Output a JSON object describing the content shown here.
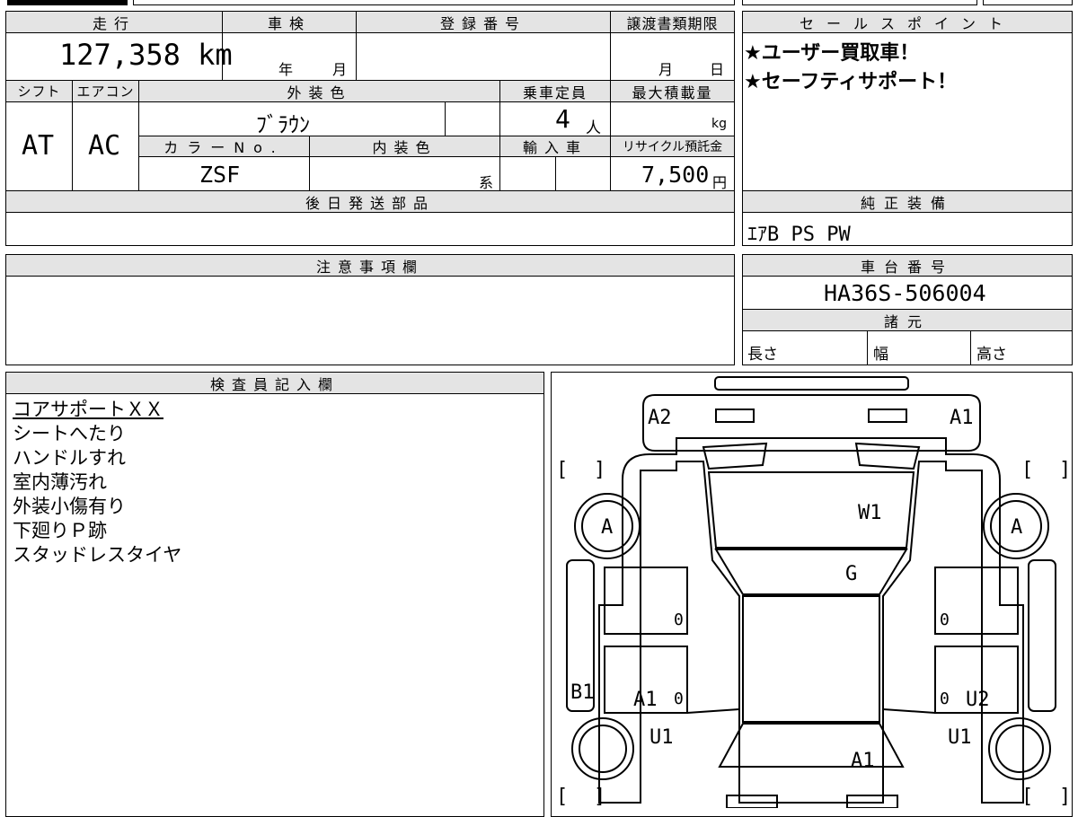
{
  "top": {
    "mileage_label": "走行",
    "mileage_value": "127,358 km",
    "inspection_label": "車検",
    "inspection_year_unit": "年",
    "inspection_month_unit": "月",
    "registration_label": "登録番号",
    "transfer_label": "譲渡書類期限",
    "transfer_month_unit": "月",
    "transfer_day_unit": "日"
  },
  "specs": {
    "shift_label": "シフト",
    "shift_value": "AT",
    "ac_label": "エアコン",
    "ac_value": "AC",
    "exterior_color_label": "外装色",
    "exterior_color_value": "ﾌﾞﾗｳﾝ",
    "capacity_label": "乗車定員",
    "capacity_value": "4",
    "capacity_unit": "人",
    "max_load_label": "最大積載量",
    "max_load_unit": "kg",
    "color_no_label": "カラーNo.",
    "color_no_value": "ZSF",
    "interior_color_label": "内装色",
    "interior_color_unit": "系",
    "import_label": "輸入車",
    "recycle_label": "リサイクル預託金",
    "recycle_value": "7,500",
    "recycle_unit": "円"
  },
  "later_parts": {
    "label": "後日発送部品"
  },
  "sales_points": {
    "label": "セールスポイント",
    "lines": [
      "★ユーザー買取車！",
      "★セーフティサポート！"
    ]
  },
  "genuine_equipment": {
    "label": "純正装備",
    "value": "ｴｱB PS PW"
  },
  "caution": {
    "label": "注意事項欄"
  },
  "chassis": {
    "label": "車台番号",
    "value": "HA36S-506004"
  },
  "dimensions": {
    "label": "諸元",
    "length": "長さ",
    "width": "幅",
    "height": "高さ"
  },
  "inspector": {
    "label": "検査員記入欄",
    "notes": [
      "コアサポートＸＸ",
      "シートへたり",
      "ハンドルすれ",
      "室内薄汚れ",
      "外装小傷有り",
      "下廻りＰ跡",
      "スタッドレスタイヤ"
    ]
  },
  "diagram_marks": {
    "front_left": "A2",
    "front_right": "A1",
    "windshield": "W1",
    "front_left_wheel": "A",
    "front_right_wheel": "A",
    "glass": "G",
    "left_front_door": "0",
    "right_front_door": "0",
    "left_rear_door": "0",
    "right_rear_door": "0",
    "left_rocker": "B1",
    "left_rear_panel": "A1",
    "right_rear_panel": "U2",
    "left_rear_wheel": "U1",
    "right_rear_wheel": "U1",
    "rear": "A1"
  }
}
